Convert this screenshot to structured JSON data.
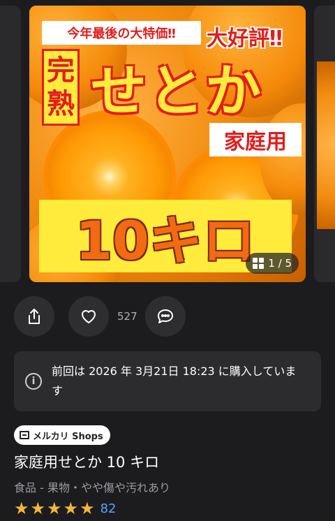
{
  "image": {
    "banner_top": "今年最後の大特価‼",
    "banner_popular": "大好評‼",
    "ripe_chars": [
      "完",
      "熟"
    ],
    "big_title": "せとか",
    "home_use": "家庭用",
    "weight": "10キロ",
    "counter": "1 / 5"
  },
  "actions": {
    "like_count": "527"
  },
  "notice": {
    "text": "前回は 2026 年 3月21日 18:23 に購入しています"
  },
  "shop_badge": "メルカリ Shops",
  "product": {
    "title": "家庭用せとか 10 キロ",
    "category": "食品 - 果物・やや傷や汚れあり",
    "rating_stars": 5,
    "rating_count": "82"
  },
  "colors": {
    "background": "#1c1c1e",
    "card": "#2c2c2e",
    "star": "#f3b63a",
    "link": "#5aa3ff"
  },
  "icons": [
    "share-icon",
    "heart-icon",
    "comment-icon",
    "info-icon",
    "gallery-icon",
    "store-icon",
    "star-icon"
  ]
}
